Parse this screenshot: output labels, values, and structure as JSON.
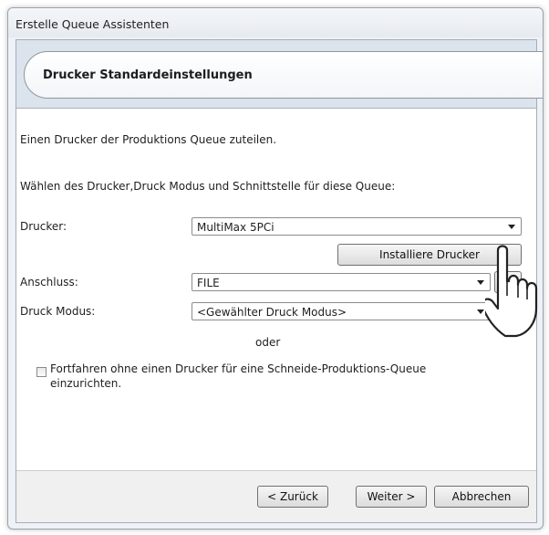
{
  "window": {
    "title": "Erstelle Queue Assistenten"
  },
  "header": {
    "title": "Drucker Standardeinstellungen"
  },
  "intro": {
    "line1": "Einen Drucker der Produktions Queue zuteilen.",
    "line2": "Wählen des Drucker,Druck Modus und Schnittstelle für diese Queue:"
  },
  "form": {
    "printer_label": "Drucker:",
    "printer_value": "MultiMax 5PCi",
    "install_button": "Installiere Drucker",
    "port_label": "Anschluss:",
    "port_value": "FILE",
    "mode_label": "Druck Modus:",
    "mode_value": "<Gewählter Druck Modus>",
    "or_text": "oder",
    "checkbox_line1": "Fortfahren ohne einen Drucker für eine Schneide-Produktions-Queue",
    "checkbox_line2": "einzurichten.",
    "checkbox_checked": false
  },
  "footer": {
    "back_button": "< Zurück",
    "next_button": "Weiter >",
    "cancel_button": "Abbrechen"
  }
}
